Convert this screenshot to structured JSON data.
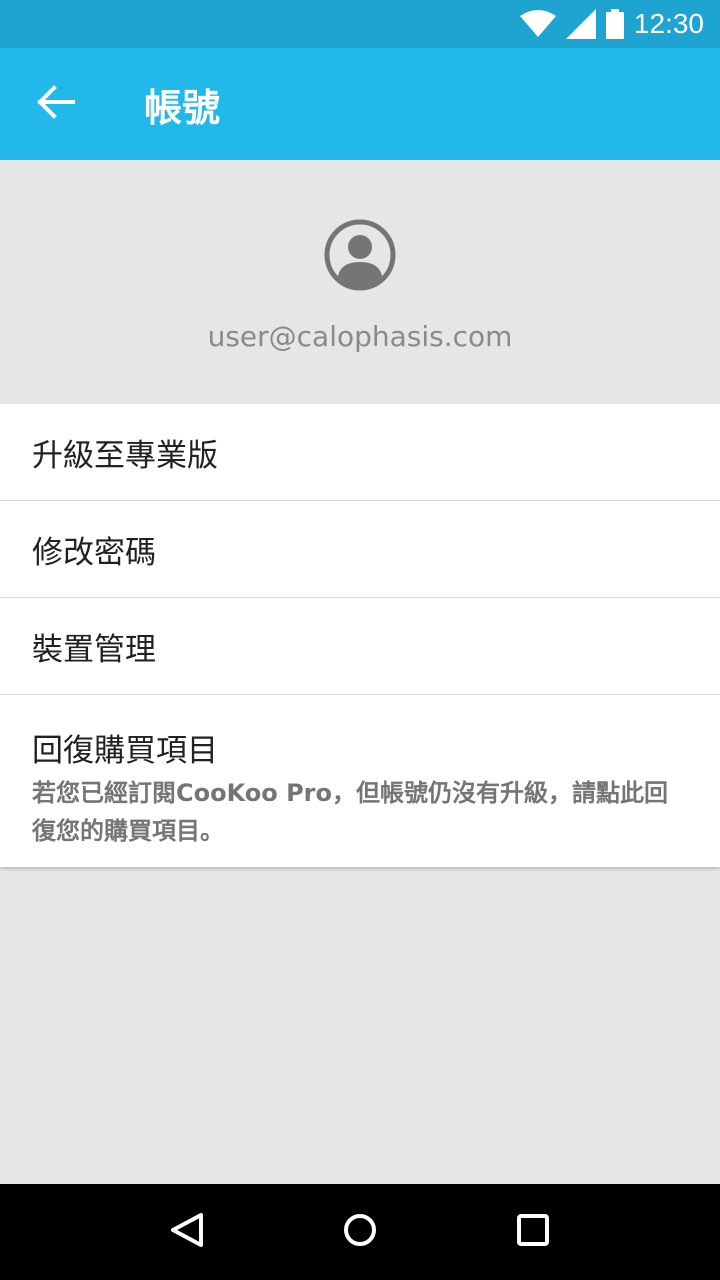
{
  "status_bar": {
    "time": "12:30",
    "icons": [
      "wifi-icon",
      "signal-icon",
      "battery-icon"
    ]
  },
  "app_bar": {
    "title": "帳號",
    "back_icon": "arrow-back-icon"
  },
  "profile": {
    "avatar_icon": "account-circle-icon",
    "email": "user@calophasis.com"
  },
  "menu": {
    "items": [
      {
        "label": "升級至專業版"
      },
      {
        "label": "修改密碼"
      },
      {
        "label": "裝置管理"
      },
      {
        "label": "回復購買項目",
        "description": "若您已經訂閱CooKoo Pro，但帳號仍沒有升級，請點此回復您的購買項目。"
      }
    ]
  },
  "nav_bar": {
    "icons": [
      "back-triangle-icon",
      "home-circle-icon",
      "recents-square-icon"
    ]
  },
  "colors": {
    "status_bar": "#1fa4d2",
    "app_bar": "#22b8ea",
    "background": "#e6e6e6"
  }
}
